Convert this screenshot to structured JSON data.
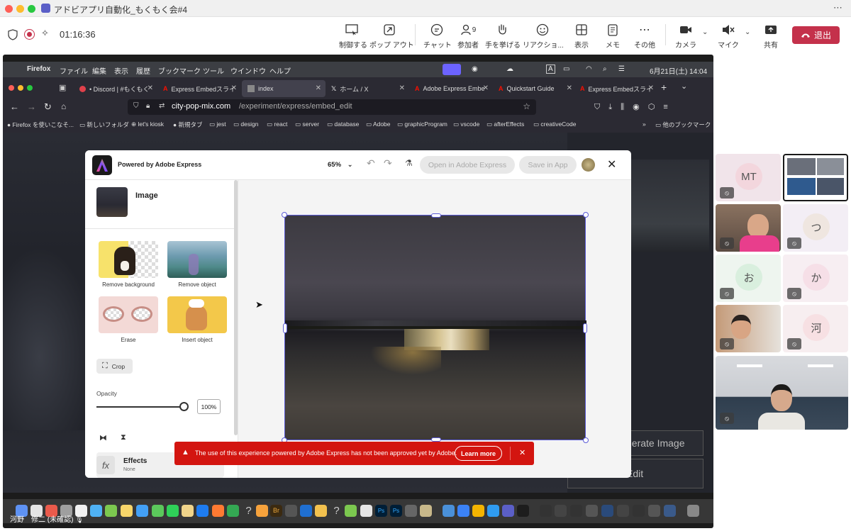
{
  "teams": {
    "title": "アドビアプリ自動化_もくもく会#4",
    "timer": "01:16:36",
    "controls": [
      {
        "label": "制御する",
        "icon": "control-icon"
      },
      {
        "label": "ポップ アウト",
        "icon": "popout-icon"
      },
      {
        "label": "チャット",
        "icon": "chat-icon"
      },
      {
        "label": "参加者",
        "icon": "people-icon",
        "badge": "9"
      },
      {
        "label": "手を挙げる",
        "icon": "raise-hand-icon"
      },
      {
        "label": "リアクショ...",
        "icon": "reaction-icon"
      },
      {
        "label": "表示",
        "icon": "view-icon"
      },
      {
        "label": "メモ",
        "icon": "notes-icon"
      },
      {
        "label": "その他",
        "icon": "more-icon"
      },
      {
        "label": "カメラ",
        "icon": "camera-icon"
      },
      {
        "label": "マイク",
        "icon": "mic-icon"
      },
      {
        "label": "共有",
        "icon": "share-icon"
      }
    ],
    "leave_label": "退出",
    "presenter_name": "河野　修二 (未確認)"
  },
  "mac_menubar": {
    "app": "Firefox",
    "menus": [
      "ファイル",
      "編集",
      "表示",
      "履歴",
      "ブックマーク",
      "ツール",
      "ウインドウ",
      "ヘルプ"
    ],
    "datetime": "6月21日(土)  14:04"
  },
  "firefox": {
    "tabs": [
      {
        "label": "• Discord | #もくもく",
        "active": false
      },
      {
        "label": "Express Embedスライ",
        "active": false
      },
      {
        "label": "index",
        "active": true
      },
      {
        "label": "ホーム / X",
        "active": false
      },
      {
        "label": "Adobe Express Embe",
        "active": false
      },
      {
        "label": "Quickstart Guide",
        "active": false
      },
      {
        "label": "Express Embedスライ",
        "active": false
      }
    ],
    "url_host": "city-pop-mix.com",
    "url_path": "/experiment/express/embed_edit",
    "bookmarks": [
      "Firefox を使いこなそ...",
      "新しいフォルダ",
      "let's kiosk",
      "新規タブ",
      "jest",
      "design",
      "react",
      "server",
      "database",
      "Adobe",
      "graphicProgram",
      "vscode",
      "afterEffects",
      "creativeCode"
    ],
    "other_bookmarks": "他のブックマーク"
  },
  "express": {
    "powered_by": "Powered by Adobe Express",
    "zoom": "65%",
    "open_label": "Open in Adobe Express",
    "save_label": "Save in App",
    "panel_title": "Image",
    "quick_actions": [
      "Remove background",
      "Remove object",
      "Erase",
      "Insert object"
    ],
    "crop_label": "Crop",
    "opacity_label": "Opacity",
    "opacity_value": "100%",
    "opacity_fraction": 1.0,
    "effects_label": "Effects",
    "effects_sub": "None",
    "toast_text": "The use of this experience powered by Adobe Express has not been approved yet by Adobe.",
    "learn_more": "Learn more"
  },
  "behind": {
    "generate": "nerate Image",
    "edit": "Edit"
  },
  "participants": [
    {
      "initials": "MT",
      "bg": "#f1e4ea",
      "av": "#f3d6dd",
      "video": false
    },
    {
      "initials": "",
      "bg": "#0b2a5c",
      "video": true
    },
    {
      "initials": "",
      "bg": "#6b4e46",
      "video": true
    },
    {
      "initials": "つ",
      "bg": "#f3eef5",
      "av": "#efe6e0",
      "video": false
    },
    {
      "initials": "お",
      "bg": "#eef5ef",
      "av": "#d9efde",
      "video": false
    },
    {
      "initials": "か",
      "bg": "#f7eef2",
      "av": "#f6dfe7",
      "video": false
    },
    {
      "initials": "",
      "bg": "#b98a6b",
      "video": true
    },
    {
      "initials": "河",
      "bg": "#f7eef0",
      "av": "#f7e0e3",
      "video": false
    }
  ]
}
